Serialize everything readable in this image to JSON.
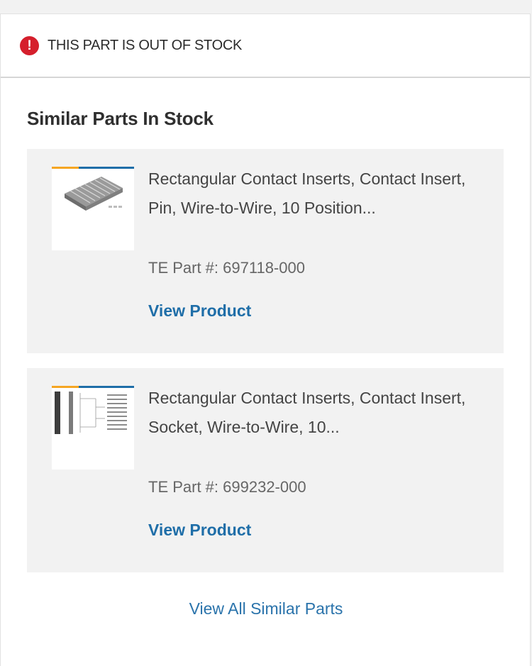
{
  "alert": {
    "icon": "exclamation-circle-icon",
    "icon_glyph": "!",
    "text": "THIS PART IS OUT OF STOCK",
    "color": "#d51f2c"
  },
  "section": {
    "title": "Similar Parts In Stock"
  },
  "products": [
    {
      "title": "Rectangular Contact Inserts, Contact Insert, Pin, Wire-to-Wire, 10 Position...",
      "part_number": "TE Part #: 697118-000",
      "link_label": "View Product",
      "image": "contact-insert-pin-product-image"
    },
    {
      "title": "Rectangular Contact Inserts, Contact Insert, Socket, Wire-to-Wire, 10...",
      "part_number": "TE Part #: 699232-000",
      "link_label": "View Product",
      "image": "contact-insert-socket-drawing-image"
    }
  ],
  "footer": {
    "view_all_label": "View All Similar Parts"
  },
  "colors": {
    "link": "#1f6ea8",
    "card_background": "#f2f2f2",
    "thumb_accent_orange": "#f5a623",
    "thumb_accent_blue": "#1f6ea8"
  }
}
